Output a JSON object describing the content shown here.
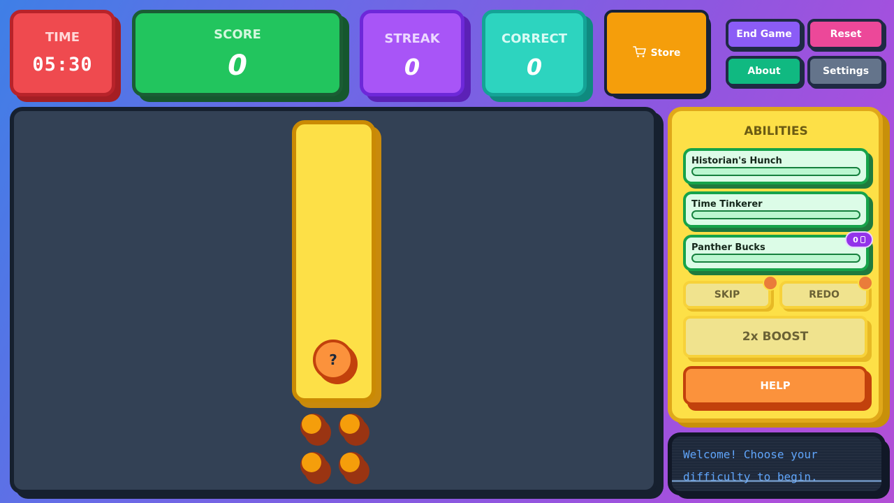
{
  "stats": {
    "time": {
      "label": "TIME",
      "value": "05:30"
    },
    "score": {
      "label": "SCORE",
      "value": "0"
    },
    "streak": {
      "label": "STREAK",
      "value": "0"
    },
    "correct": {
      "label": "CORRECT",
      "value": "0"
    }
  },
  "store": {
    "label": "Store",
    "icon": "cart-icon"
  },
  "controls": {
    "end_game": "End Game",
    "reset": "Reset",
    "about": "About",
    "settings": "Settings"
  },
  "board": {
    "mystery_symbol": "?"
  },
  "abilities": {
    "title": "ABILITIES",
    "items": [
      {
        "name": "Historian's Hunch",
        "progress": 0
      },
      {
        "name": "Time Tinkerer",
        "progress": 0
      },
      {
        "name": "Panther Bucks",
        "progress": 0
      }
    ],
    "bucks_count": "0",
    "skip": "SKIP",
    "redo": "REDO",
    "boost": "2x BOOST",
    "help": "HELP"
  },
  "message": "Welcome! Choose your difficulty to begin.",
  "colors": {
    "time": "#ef4a4f",
    "score": "#22c55e",
    "streak": "#a855f7",
    "correct": "#2dd4bf",
    "store": "#f59e0b",
    "board": "#334155",
    "abilities": "#fde047"
  }
}
